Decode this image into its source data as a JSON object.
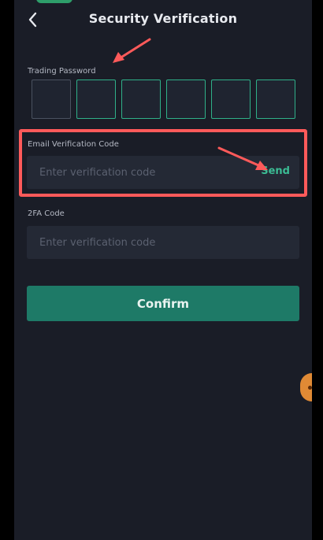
{
  "header": {
    "title": "Security Verification",
    "back_icon": "chevron-left-icon"
  },
  "trading_password": {
    "label": "Trading Password",
    "digits": 6
  },
  "email_code": {
    "label": "Email Verification Code",
    "placeholder": "Enter verification code",
    "value": "",
    "send_label": "Send"
  },
  "twofa": {
    "label": "2FA Code",
    "placeholder": "Enter verification code",
    "value": ""
  },
  "confirm_label": "Confirm",
  "colors": {
    "background": "#1a1d27",
    "accent": "#1e7a67",
    "send_text": "#3bbc94",
    "pin_active_border": "#2fb089",
    "annotation": "#ff5a5a"
  },
  "annotations": {
    "arrow_icon": "red-arrow-icon",
    "highlight": "red-highlight-box"
  }
}
